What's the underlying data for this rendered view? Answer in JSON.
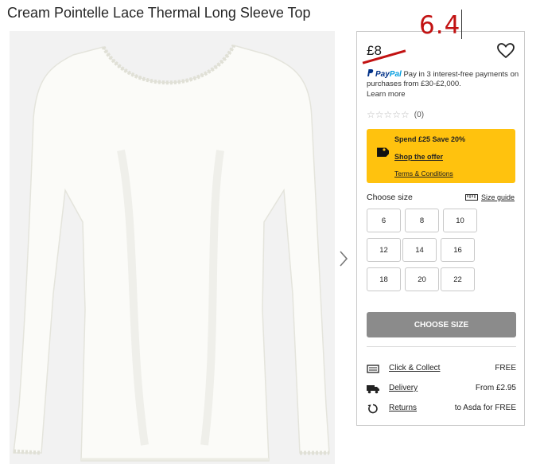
{
  "product": {
    "title": "Cream Pointelle Lace Thermal Long Sleeve Top",
    "price": "£8",
    "handwritten_price": "6.4"
  },
  "paypal": {
    "brand_pay": "Pay",
    "brand_pal": "Pal",
    "text": "Pay in 3 interest-free payments on purchases from £30-£2,000.",
    "learn_more": "Learn more"
  },
  "rating": {
    "stars": "☆☆☆☆☆",
    "count": "(0)",
    "value": 0
  },
  "offer": {
    "headline": "Spend £25 Save 20%",
    "shop_link": "Shop the offer",
    "terms_link": "Terms & Conditions",
    "background": "#ffc20e"
  },
  "sizes": {
    "label": "Choose size",
    "guide_label": "Size guide",
    "options": [
      "6",
      "8",
      "10",
      "12",
      "14",
      "16",
      "18",
      "20",
      "22"
    ]
  },
  "cta": {
    "label": "CHOOSE SIZE",
    "color": "#8b8b8b"
  },
  "delivery": [
    {
      "icon": "store-icon",
      "label": "Click & Collect",
      "value": "FREE"
    },
    {
      "icon": "truck-icon",
      "label": "Delivery",
      "value": "From £2.95"
    },
    {
      "icon": "return-icon",
      "label": "Returns",
      "value": "to Asda for FREE"
    }
  ],
  "colors": {
    "strike": "#c21212",
    "text": "#1a1a1a"
  }
}
